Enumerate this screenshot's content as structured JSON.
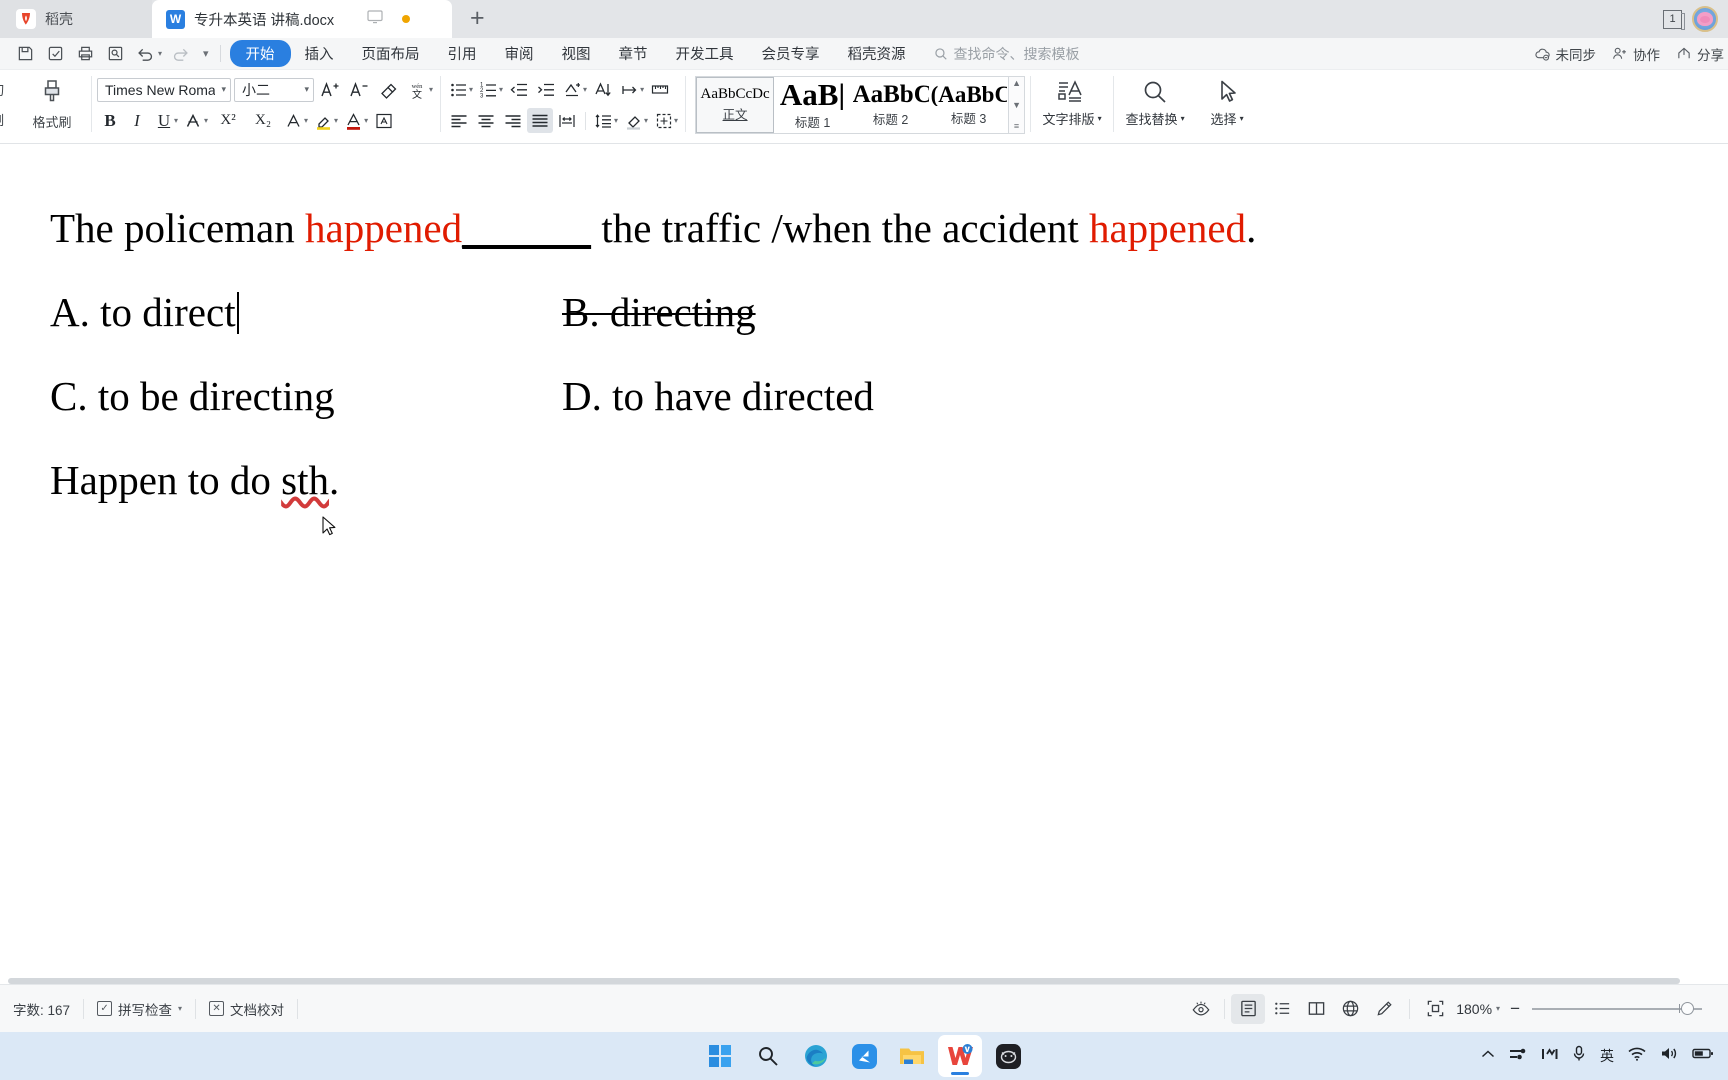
{
  "tabbar": {
    "cloud_tab_label": "稻壳",
    "doc_tab_title": "专升本英语 讲稿.docx",
    "new_tab_label": "+",
    "window_count": "1"
  },
  "menubar": {
    "items": [
      {
        "label": "开始",
        "active": true
      },
      {
        "label": "插入",
        "active": false
      },
      {
        "label": "页面布局",
        "active": false
      },
      {
        "label": "引用",
        "active": false
      },
      {
        "label": "审阅",
        "active": false
      },
      {
        "label": "视图",
        "active": false
      },
      {
        "label": "章节",
        "active": false
      },
      {
        "label": "开发工具",
        "active": false
      },
      {
        "label": "会员专享",
        "active": false
      },
      {
        "label": "稻壳资源",
        "active": false
      }
    ],
    "search_placeholder": "查找命令、搜索模板",
    "sync_status": "未同步",
    "collaborate": "协作",
    "share": "分享"
  },
  "ribbon": {
    "clipboard": {
      "cut_label": "剪切",
      "copy_label": "复制",
      "format_brush_label": "格式刷"
    },
    "font": {
      "font_name": "Times New Roma",
      "font_size": "小二",
      "bold": "B",
      "italic": "I",
      "underline": "U",
      "superscript": "X²",
      "subscript": "X₂"
    },
    "styles": [
      {
        "preview": "AaBbCcDc",
        "name": "正文",
        "size": "15px",
        "weight": "400",
        "selected": true
      },
      {
        "preview": "AaB|",
        "name": "标题 1",
        "size": "31px",
        "weight": "700",
        "selected": false
      },
      {
        "preview": "AaBbC",
        "name": "标题 2",
        "size": "25px",
        "weight": "700",
        "selected": false
      },
      {
        "preview": "(AaBbC",
        "name": "标题 3",
        "size": "23px",
        "weight": "700",
        "selected": false
      }
    ],
    "typography_label": "文字排版",
    "find_replace_label": "查找替换",
    "select_label": "选择"
  },
  "document": {
    "line1": {
      "part1": "The policeman ",
      "highlight1": "happened",
      "blank": "______",
      "part2": " the traffic /when the accident ",
      "highlight2": "happened",
      "part3": "."
    },
    "options": [
      {
        "left": "A. to direct",
        "right": "B. directing",
        "right_strike": true,
        "caret_after_left": true
      },
      {
        "left": "C. to be directing",
        "right": "D. to have directed",
        "right_strike": false,
        "caret_after_left": false
      }
    ],
    "line_last_pre": "Happen to do ",
    "line_last_spell": "sth",
    "line_last_post": ".",
    "highlight_color": "#e01b00"
  },
  "statusbar": {
    "word_count": "字数: 167",
    "spell_check": "拼写检查",
    "proofread": "文档校对",
    "zoom_level": "180%",
    "zoom_out": "−",
    "views": [
      "page-view-icon",
      "outline-view-icon",
      "book-view-icon",
      "web-view-icon",
      "edit-pen-icon"
    ]
  },
  "taskbar": {
    "apps": [
      {
        "name": "start-button"
      },
      {
        "name": "search-button"
      },
      {
        "name": "edge-browser"
      },
      {
        "name": "blue-app"
      },
      {
        "name": "file-explorer"
      },
      {
        "name": "wps-office"
      },
      {
        "name": "dark-app"
      }
    ],
    "ime_label": "英"
  }
}
